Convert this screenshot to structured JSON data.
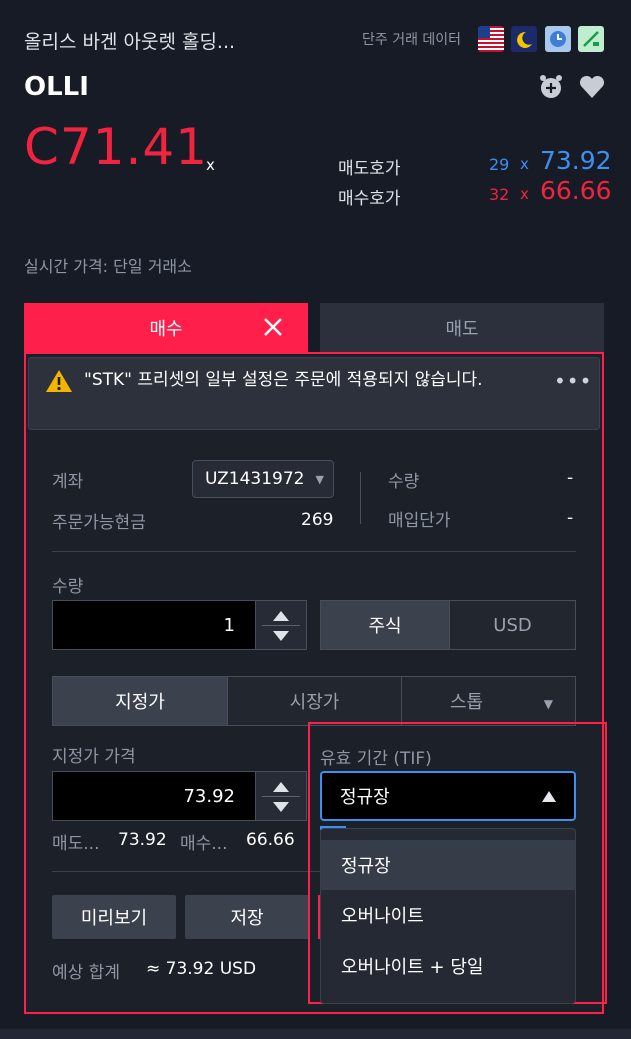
{
  "header": {
    "company_name": "올리스 바겐 아웃렛 홀딩...",
    "data_label": "단주 거래 데이터",
    "symbol": "OLLI",
    "price": "C71.41",
    "price_suffix": "x",
    "realtime_label": "실시간 가격: 단일 거래소"
  },
  "quote": {
    "ask_label": "매도호가",
    "ask_size": "29",
    "ask_x": "x",
    "ask_price": "73.92",
    "bid_label": "매수호가",
    "bid_size": "32",
    "bid_x": "x",
    "bid_price": "66.66"
  },
  "tabs": {
    "buy": "매수",
    "sell": "매도"
  },
  "warning": {
    "text": "\"STK\" 프리셋의 일부 설정은 주문에 적용되지 않습니다.",
    "more": "•••"
  },
  "account": {
    "account_label": "계좌",
    "account_value": "UZ1431972",
    "cash_label": "주문가능현금",
    "cash_value": "269",
    "position_qty_label": "수량",
    "position_qty_value": "-",
    "avg_price_label": "매입단가",
    "avg_price_value": "-"
  },
  "quantity": {
    "label": "수량",
    "value": "1",
    "unit_shares": "주식",
    "unit_usd": "USD"
  },
  "order_type": {
    "limit": "지정가",
    "market": "시장가",
    "stop": "스톱"
  },
  "limit_price": {
    "label": "지정가 가격",
    "value": "73.92",
    "ask_short": "매도...",
    "ask_value": "73.92",
    "bid_short": "매수...",
    "bid_value": "66.66"
  },
  "tif": {
    "label": "유효 기간 (TIF)",
    "selected": "정규장",
    "options": [
      "정규장",
      "오버나이트",
      "오버나이트 + 당일"
    ]
  },
  "actions": {
    "preview": "미리보기",
    "save": "저장"
  },
  "estimate": {
    "label": "예상 합계",
    "value": "≈ 73.92 USD"
  },
  "colors": {
    "buy_red": "#ff1f4a",
    "price_red": "#f0243e",
    "ask_blue": "#3d8ff0"
  }
}
